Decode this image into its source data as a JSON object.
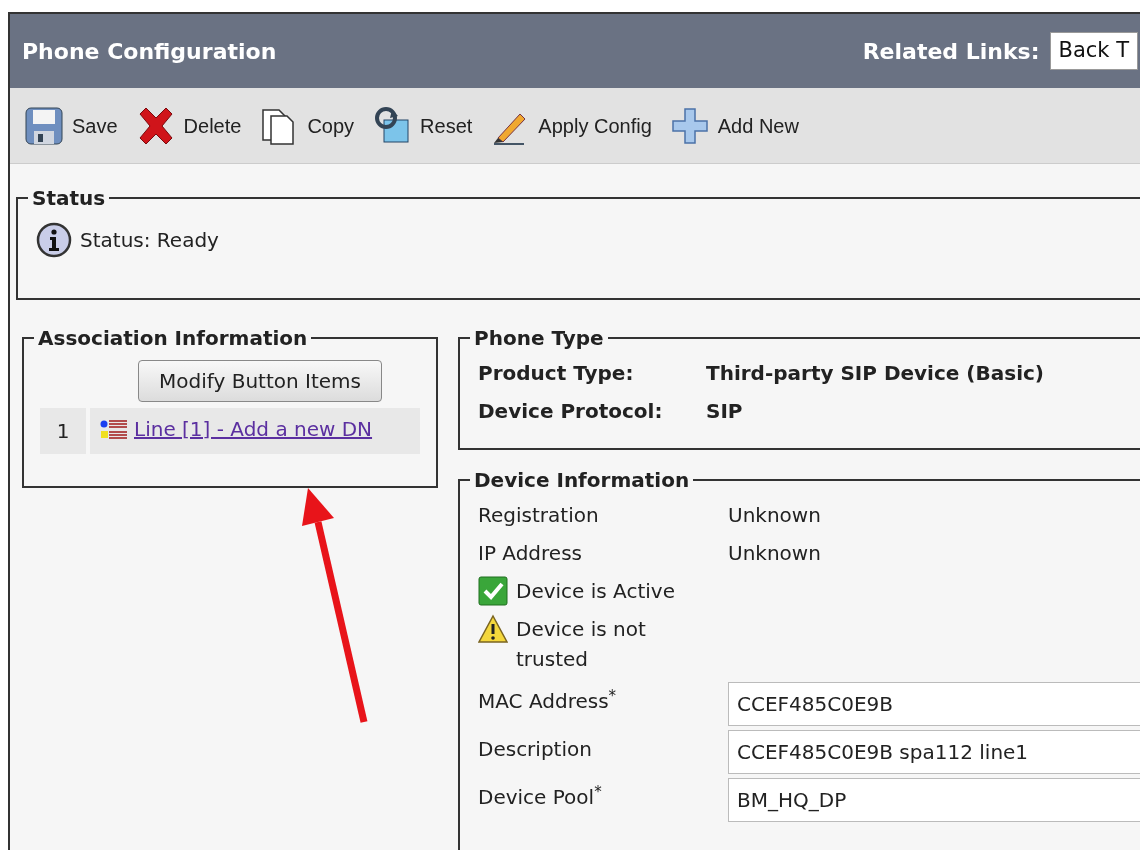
{
  "header": {
    "title": "Phone Configuration",
    "related_links_label": "Related Links:",
    "related_links_value": "Back T"
  },
  "toolbar": [
    {
      "kind": "save",
      "label": "Save"
    },
    {
      "kind": "delete",
      "label": "Delete"
    },
    {
      "kind": "copy",
      "label": "Copy"
    },
    {
      "kind": "reset",
      "label": "Reset"
    },
    {
      "kind": "apply",
      "label": "Apply Config"
    },
    {
      "kind": "add",
      "label": "Add New"
    }
  ],
  "status": {
    "legend": "Status",
    "message": "Status: Ready"
  },
  "association": {
    "legend": "Association Information",
    "button": "Modify Button Items",
    "rows": [
      {
        "index": "1",
        "link": "Line [1] - Add a new DN"
      }
    ]
  },
  "phone_type": {
    "legend": "Phone Type",
    "fields": [
      {
        "label": "Product Type:",
        "value": "Third-party SIP Device (Basic)"
      },
      {
        "label": "Device Protocol:",
        "value": "SIP"
      }
    ]
  },
  "device_information": {
    "legend": "Device Information",
    "rows": [
      {
        "kind": "text",
        "label": "Registration",
        "value": "Unknown"
      },
      {
        "kind": "text",
        "label": "IP Address",
        "value": "Unknown"
      },
      {
        "kind": "check",
        "label": "Device is Active"
      },
      {
        "kind": "warning",
        "label": "Device is not trusted"
      },
      {
        "kind": "input",
        "label": "MAC Address",
        "required_mark": "*",
        "value": "CCEF485C0E9B"
      },
      {
        "kind": "input",
        "label": "Description",
        "value": "CCEF485C0E9B spa112 line1"
      },
      {
        "kind": "input",
        "label": "Device Pool",
        "required_mark": "*",
        "value": "BM_HQ_DP"
      }
    ]
  }
}
